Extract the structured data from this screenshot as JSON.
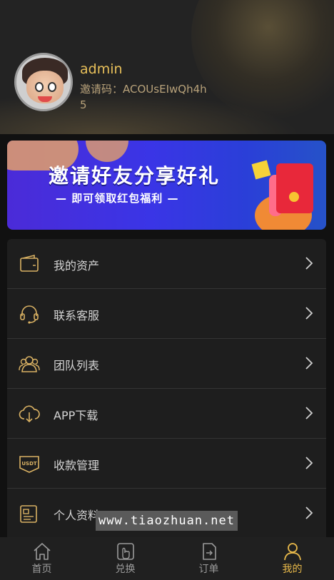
{
  "profile": {
    "username": "admin",
    "invite_label": "邀请码：",
    "invite_code": "ACOUsEIwQh4h5"
  },
  "banner": {
    "title": "邀请好友分享好礼",
    "subtitle": "— 即可领取红包福利 —"
  },
  "menu": {
    "items": [
      {
        "label": "我的资产",
        "icon": "wallet-icon"
      },
      {
        "label": "联系客服",
        "icon": "headset-icon"
      },
      {
        "label": "团队列表",
        "icon": "team-icon"
      },
      {
        "label": "APP下载",
        "icon": "cloud-download-icon"
      },
      {
        "label": "收款管理",
        "icon": "usdt-icon",
        "icon_text": "USDT"
      },
      {
        "label": "个人资料",
        "icon": "profile-card-icon"
      }
    ]
  },
  "watermark": "www.tiaozhuan.net",
  "tabbar": {
    "tabs": [
      {
        "label": "首页",
        "icon": "home-icon"
      },
      {
        "label": "兑换",
        "icon": "exchange-icon"
      },
      {
        "label": "订单",
        "icon": "order-icon"
      },
      {
        "label": "我的",
        "icon": "user-icon",
        "active": true
      }
    ]
  },
  "colors": {
    "accent": "#e8b94a",
    "icon_gold": "#d9b163",
    "background": "#111111",
    "panel": "#1e1e1e"
  }
}
